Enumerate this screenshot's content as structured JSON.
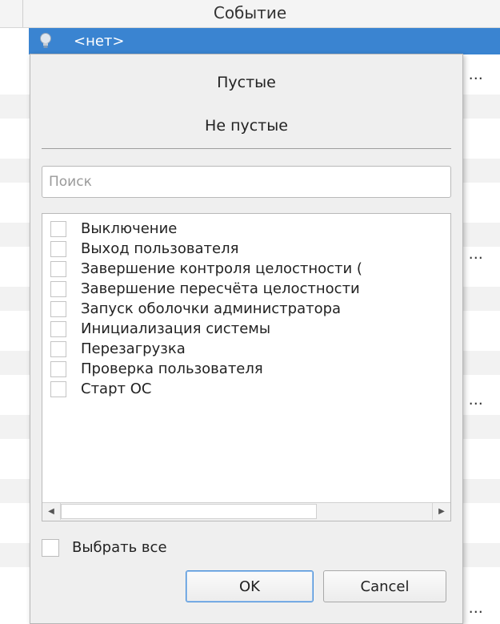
{
  "table": {
    "column_header": "Событие",
    "truncated_cell": "а ..."
  },
  "selected_row": {
    "text": "<нет>",
    "icon": "lightbulb-icon",
    "highlight_color": "#3a84d1"
  },
  "popup": {
    "menu_items": [
      "Пустые",
      "Не пустые"
    ],
    "search": {
      "placeholder": "Поиск",
      "value": ""
    },
    "options": [
      {
        "label": "Выключение",
        "checked": false
      },
      {
        "label": "Выход пользователя",
        "checked": false
      },
      {
        "label": "Завершение контроля целостности (",
        "checked": false
      },
      {
        "label": "Завершение пересчёта целостности",
        "checked": false
      },
      {
        "label": "Запуск оболочки администратора",
        "checked": false
      },
      {
        "label": "Инициализация системы",
        "checked": false
      },
      {
        "label": "Перезагрузка",
        "checked": false
      },
      {
        "label": "Проверка пользователя",
        "checked": false
      },
      {
        "label": "Старт ОС",
        "checked": false
      }
    ],
    "select_all": {
      "label": "Выбрать все",
      "checked": false
    },
    "ok_label": "OK",
    "cancel_label": "Cancel"
  }
}
